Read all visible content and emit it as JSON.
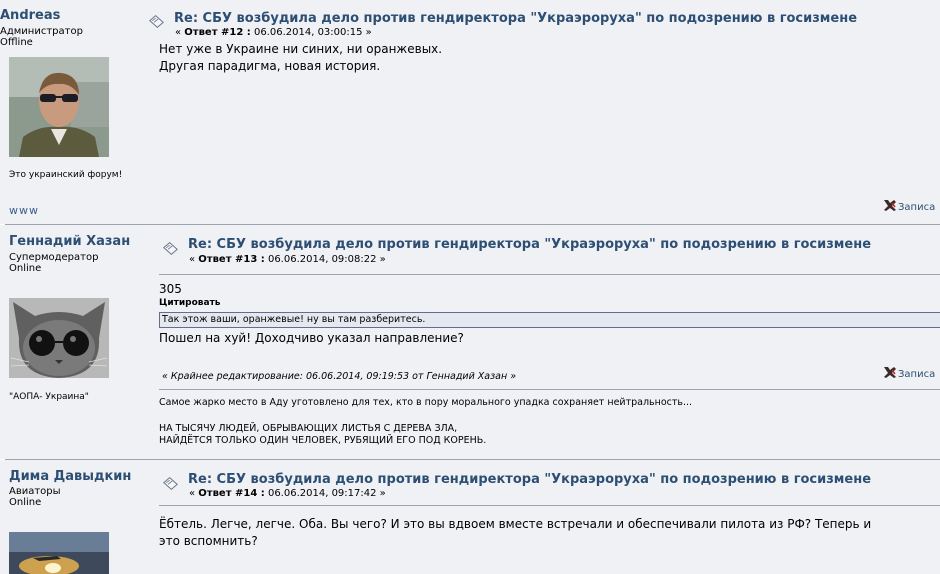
{
  "posts": [
    {
      "author": "Andreas",
      "rank": "Администратор",
      "status": "Offline",
      "signature_left": "Это украинский форум!",
      "www": "www",
      "title": "Re: СБУ возбудила дело против гендиректора \"Украэроруха\" по подозрению в госизмене",
      "reply_label": "Ответ #12 :",
      "date": "06.06.2014, 03:00:15",
      "body": [
        "Нет уже в Украине ни синих, ни оранжевых.",
        "Другая парадигма, новая история."
      ],
      "report": "Записа"
    },
    {
      "author": "Геннадий Хазан",
      "rank": "Супермодератор",
      "status": "Online",
      "signature_left": "\"АОПА- Украина\"",
      "title": "Re: СБУ возбудила дело против гендиректора \"Украэроруха\" по подозрению в госизмене",
      "reply_label": "Ответ #13 :",
      "date": "06.06.2014, 09:08:22",
      "body_before_quote": "305",
      "quote_header": "Цитировать",
      "quote_text": "Так этож ваши, оранжевые! ну вы там разберитесь.",
      "body_after_quote": "Пошел на хуй!  Доходчиво указал направление?",
      "edited": "« Крайнее редактирование: 06.06.2014, 09:19:53 от Геннадий Хазан »",
      "report": "Записа",
      "signature": [
        "Самое жарко место в Аду уготовлено для тех, кто в пору морального упадка сохраняет нейтральность...",
        "",
        "НА ТЫСЯЧУ ЛЮДЕЙ, ОБРЫВАЮЩИХ ЛИСТЬЯ С ДЕРЕВА ЗЛА,",
        "НАЙДЁТСЯ ТОЛЬКО ОДИН ЧЕЛОВЕК, РУБЯЩИЙ ЕГО ПОД КОРЕНЬ."
      ]
    },
    {
      "author": "Дима Давыдкин",
      "rank": "Авиаторы",
      "status": "Online",
      "title": "Re: СБУ возбудила дело против гендиректора \"Украэроруха\" по подозрению в госизмене",
      "reply_label": "Ответ #14 :",
      "date": "06.06.2014, 09:17:42",
      "body": [
        "Ёбтель. Легче, легче. Оба. Вы чего? И это вы вдвоем вместе встречали и обеспечивали пилота из РФ? Теперь и",
        "это вспомнить?"
      ]
    }
  ],
  "colors": {
    "link": "#2d4f74",
    "post_bg": "#f0f1f5",
    "quote_bg": "#e6e8f1"
  }
}
